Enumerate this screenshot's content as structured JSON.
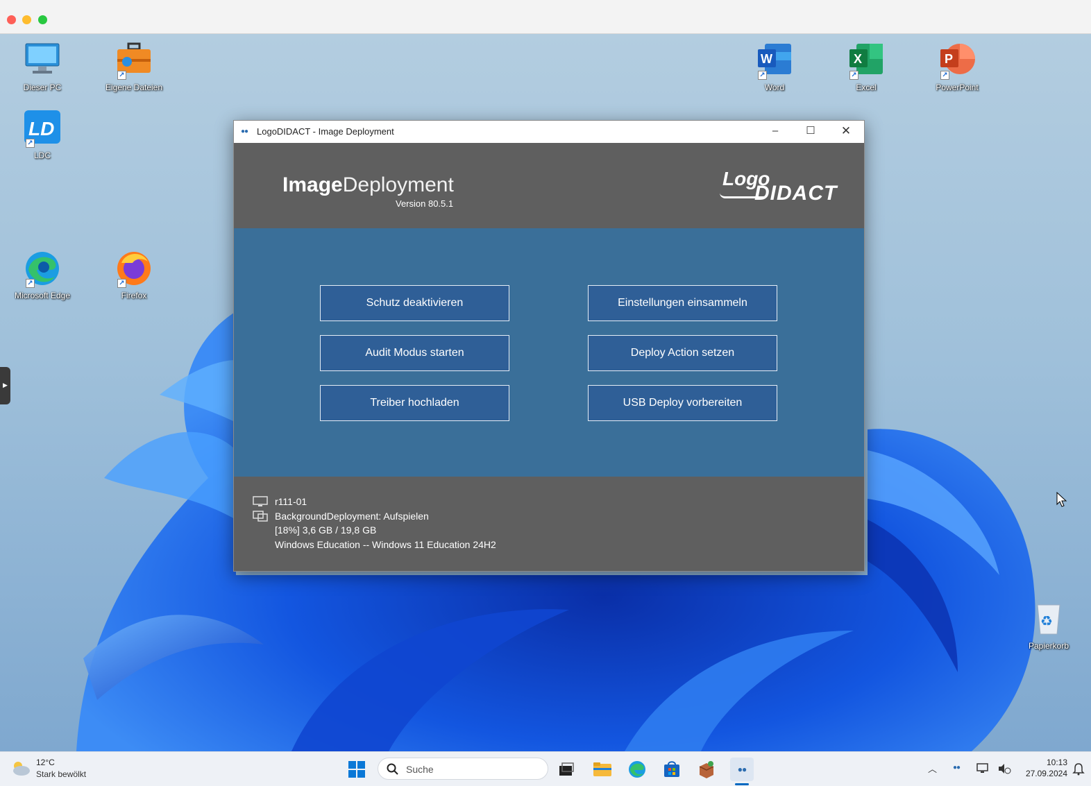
{
  "desktop": {
    "icons": [
      {
        "label": "Dieser PC",
        "icon": "computer-icon"
      },
      {
        "label": "Eigene Dateien",
        "icon": "briefcase-icon"
      },
      {
        "label": "LDC",
        "icon": "ldc-icon"
      },
      {
        "label": "Microsoft Edge",
        "icon": "edge-icon"
      },
      {
        "label": "Firefox",
        "icon": "firefox-icon"
      },
      {
        "label": "Word",
        "icon": "word-icon"
      },
      {
        "label": "Excel",
        "icon": "excel-icon"
      },
      {
        "label": "PowerPoint",
        "icon": "powerpoint-icon"
      },
      {
        "label": "Papierkorb",
        "icon": "recycle-bin-icon"
      }
    ]
  },
  "window": {
    "title": "LogoDIDACT - Image Deployment",
    "brand_bold": "Image",
    "brand_light": "Deployment",
    "version": "Version 80.5.1",
    "logo_top": "Logo",
    "logo_bottom": "DIDACT",
    "buttons": [
      "Schutz deaktivieren",
      "Einstellungen einsammeln",
      "Audit Modus starten",
      "Deploy Action setzen",
      "Treiber hochladen",
      "USB Deploy vorbereiten"
    ],
    "status": {
      "hostname": "r111-01",
      "deployment": "BackgroundDeployment: Aufspielen",
      "progress_text": "[18%] 3,6 GB / 19,8 GB",
      "progress_percent": 18,
      "image": "Windows Education -- Windows 11 Education 24H2"
    }
  },
  "taskbar": {
    "weather_temp": "12°C",
    "weather_condition": "Stark bewölkt",
    "search_placeholder": "Suche",
    "time": "10:13",
    "date": "27.09.2024"
  },
  "colors": {
    "window_main": "#3a6f99",
    "window_header": "#5f5f5f",
    "button_bg": "#2f5f97"
  }
}
